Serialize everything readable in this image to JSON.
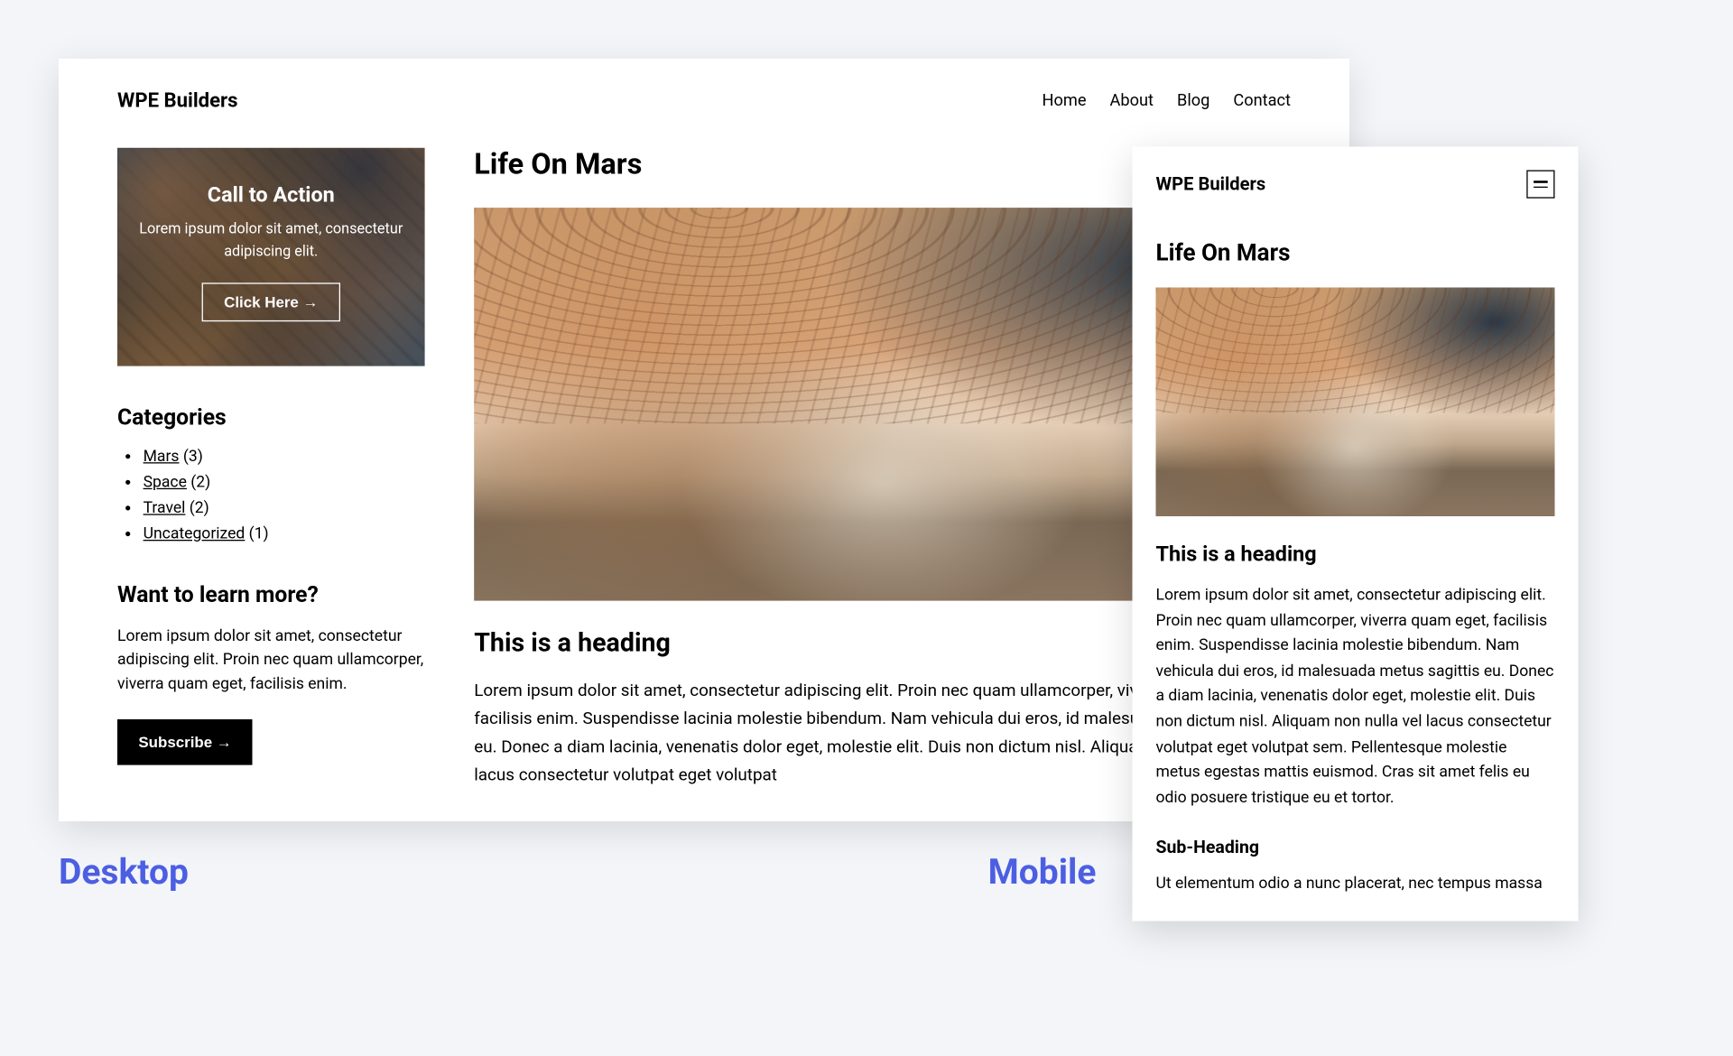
{
  "labels": {
    "desktop": "Desktop",
    "mobile": "Mobile"
  },
  "brand": "WPE Builders",
  "nav": [
    "Home",
    "About",
    "Blog",
    "Contact"
  ],
  "cta": {
    "title": "Call to Action",
    "desc": "Lorem ipsum dolor sit amet, consectetur adipiscing elit.",
    "button": "Click Here →"
  },
  "categories": {
    "heading": "Categories",
    "items": [
      {
        "name": "Mars",
        "count": "(3)"
      },
      {
        "name": "Space",
        "count": "(2)"
      },
      {
        "name": "Travel",
        "count": "(2)"
      },
      {
        "name": "Uncategorized",
        "count": "(1)"
      }
    ]
  },
  "learn": {
    "heading": "Want to learn more?",
    "desc": "Lorem ipsum dolor sit amet, consectetur adipiscing elit. Proin nec quam ullamcorper, viverra quam eget, facilisis enim.",
    "button": "Subscribe →"
  },
  "article": {
    "title": "Life On Mars",
    "heading": "This is a heading",
    "body": "Lorem ipsum dolor sit amet, consectetur adipiscing elit. Proin nec quam ullamcorper, viverra quam eget, facilisis enim. Suspendisse lacinia molestie bibendum. Nam vehicula dui eros, id malesuada metus sagittis eu. Donec a diam lacinia, venenatis dolor eget, molestie elit. Duis non dictum nisl. Aliquam non nulla vel lacus consectetur volutpat eget volutpat"
  },
  "mobile": {
    "brand": "WPE Builders",
    "title": "Life On Mars",
    "heading": "This is a heading",
    "body": "Lorem ipsum dolor sit amet, consectetur adipiscing elit. Proin nec quam ullamcorper, viverra quam eget, facilisis enim. Suspendisse lacinia molestie bibendum. Nam vehicula dui eros, id malesuada metus sagittis eu. Donec a diam lacinia, venenatis dolor eget, molestie elit. Duis non dictum nisl. Aliquam non nulla vel lacus consectetur volutpat eget volutpat sem. Pellentesque molestie metus egestas mattis euismod. Cras sit amet felis eu odio posuere tristique eu et tortor.",
    "subheading": "Sub-Heading",
    "body2": "Ut elementum odio a nunc placerat, nec tempus massa"
  }
}
